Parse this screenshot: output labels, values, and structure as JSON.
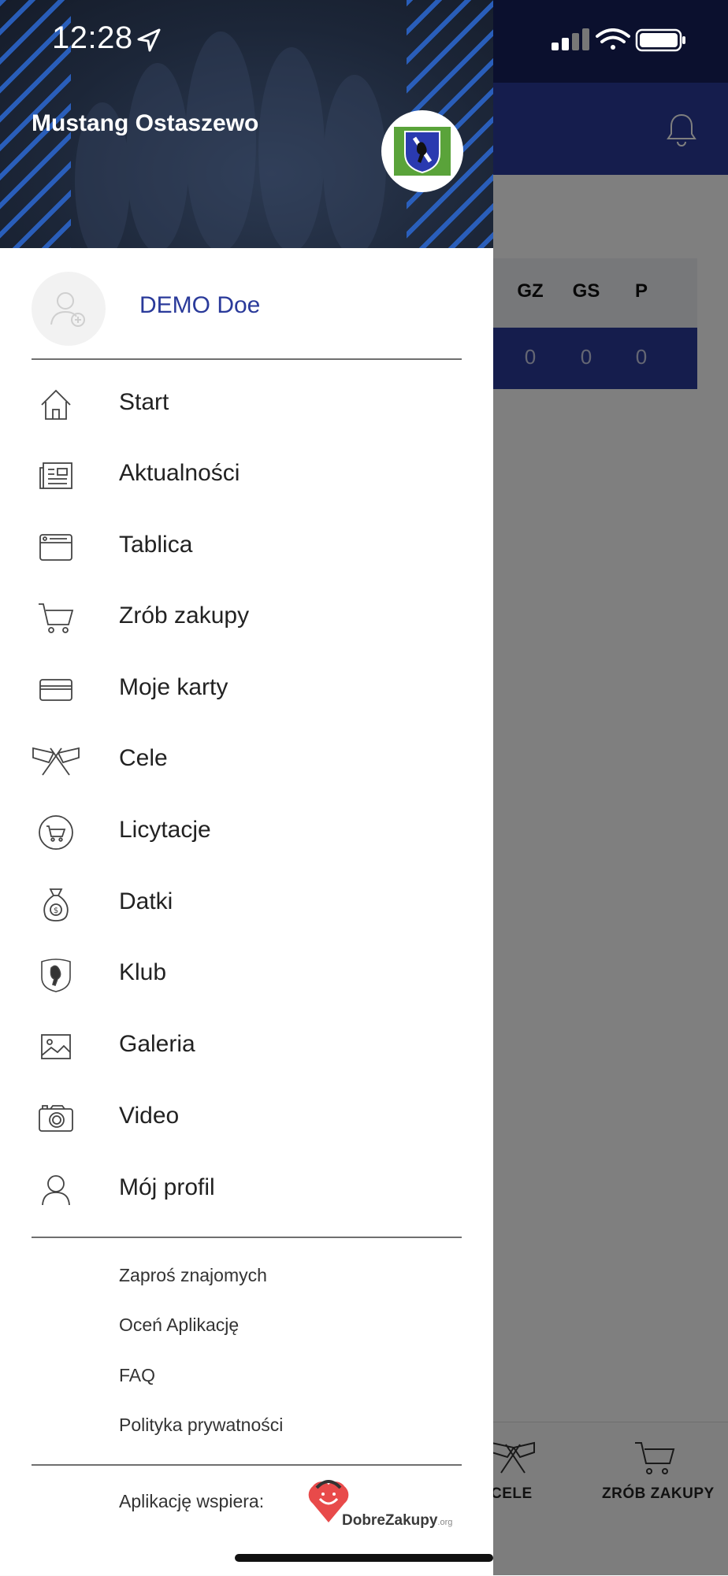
{
  "status_bar": {
    "time": "12:28"
  },
  "club": {
    "name": "Mustang Ostaszewo"
  },
  "user": {
    "name": "DEMO Doe"
  },
  "menu": [
    {
      "label": "Start",
      "icon": "home-icon"
    },
    {
      "label": "Aktualności",
      "icon": "newspaper-icon"
    },
    {
      "label": "Tablica",
      "icon": "board-icon"
    },
    {
      "label": "Zrób zakupy",
      "icon": "cart-icon"
    },
    {
      "label": "Moje karty",
      "icon": "card-icon"
    },
    {
      "label": "Cele",
      "icon": "flags-icon"
    },
    {
      "label": "Licytacje",
      "icon": "auction-icon"
    },
    {
      "label": "Datki",
      "icon": "money-bag-icon"
    },
    {
      "label": "Klub",
      "icon": "club-crest-icon"
    },
    {
      "label": "Galeria",
      "icon": "image-icon"
    },
    {
      "label": "Video",
      "icon": "camera-icon"
    },
    {
      "label": "Mój profil",
      "icon": "user-icon"
    }
  ],
  "links": [
    "Zaproś znajomych",
    "Oceń Aplikację",
    "FAQ",
    "Polityka prywatności"
  ],
  "support": {
    "label": "Aplikację wspiera:",
    "brand": "DobreZakupy",
    "brand_suffix": ".org"
  },
  "background": {
    "table_headers": [
      "GZ",
      "GS",
      "P"
    ],
    "table_values": [
      "0",
      "0",
      "0"
    ],
    "tabs": [
      "CELE",
      "ZRÓB ZAKUPY"
    ]
  },
  "colors": {
    "primary": "#2a3a9a",
    "dark_navy": "#17215c",
    "accent_blue": "#2c68d1"
  }
}
